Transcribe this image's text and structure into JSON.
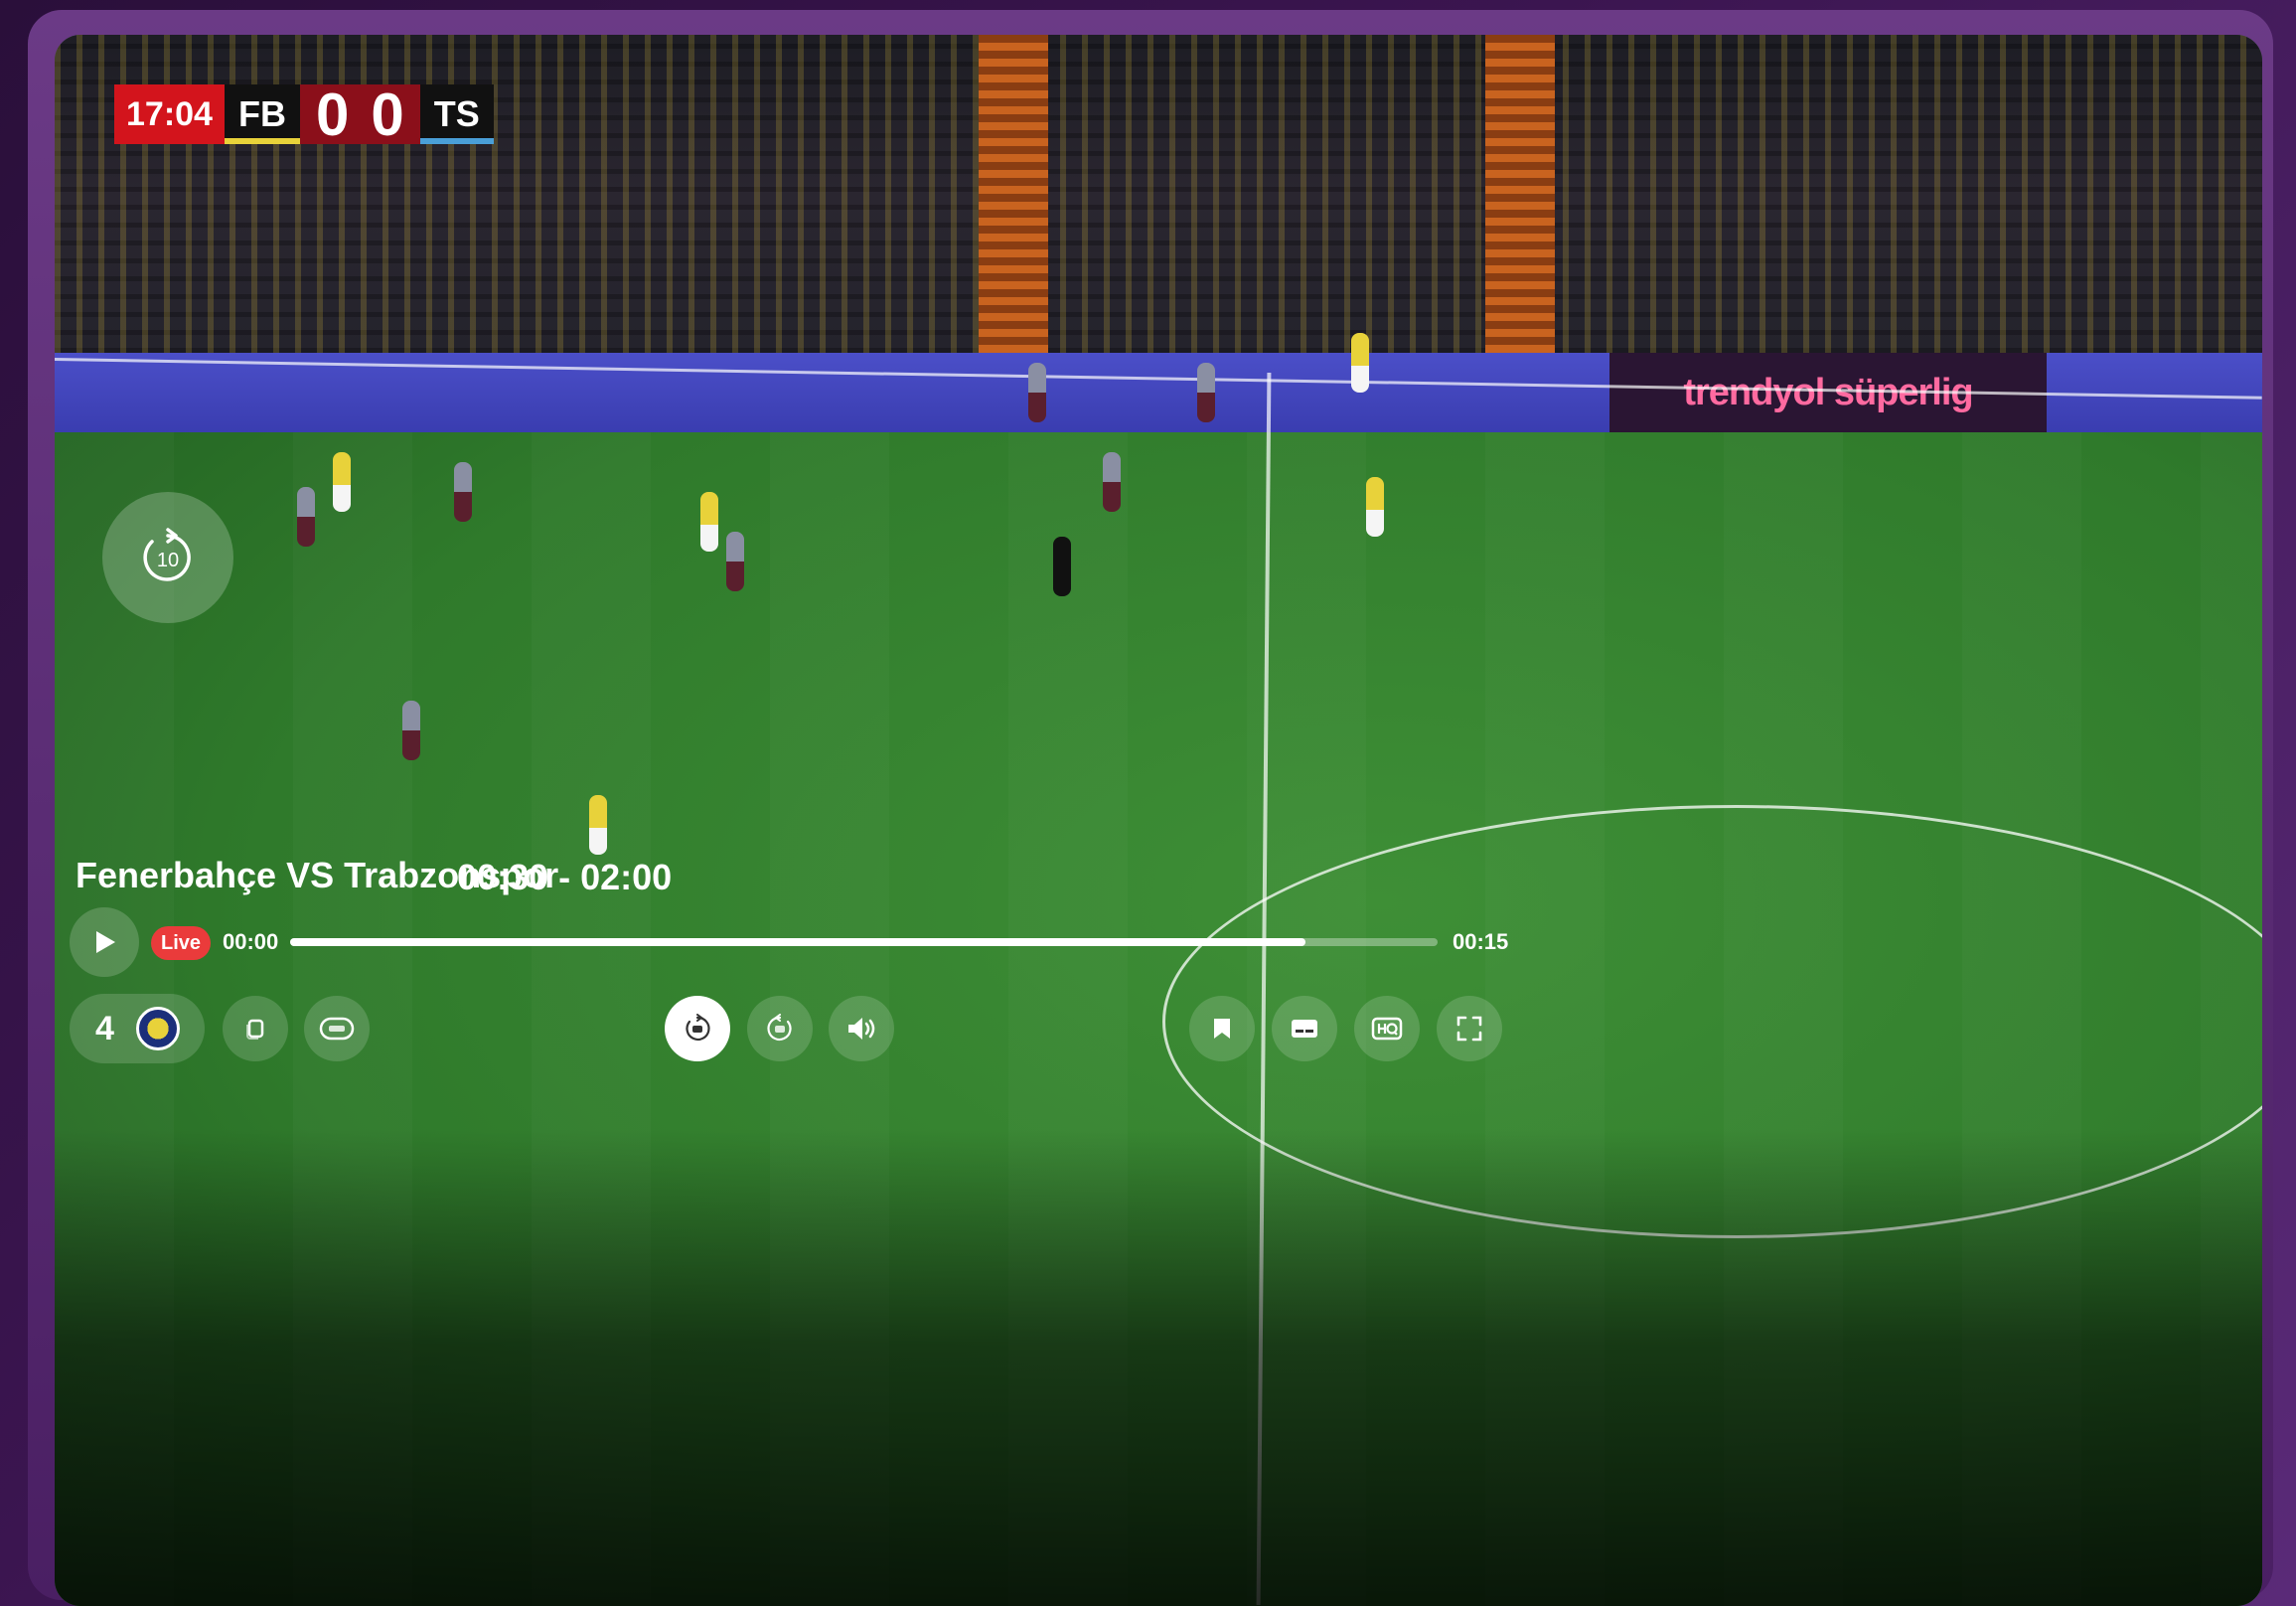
{
  "scoreboard": {
    "clock": "17:04",
    "home": "FB",
    "home_goals": "0",
    "away_goals": "0",
    "away": "TS"
  },
  "ad_board": {
    "brand": "trendyol süperlig"
  },
  "match": {
    "title": "Fenerbahçe VS Trabzonspor",
    "time_range": "00:30 - 02:00"
  },
  "playback": {
    "live_label": "Live",
    "current_time": "00:00",
    "end_time": "00:15",
    "progress": 0.885
  },
  "channel": {
    "number": "4"
  },
  "icons": {
    "replay_big": "replay-10-icon",
    "play": "play-icon",
    "copy": "copy-icon",
    "epg": "epg-icon",
    "rewind": "rewind-10-icon",
    "forward": "forward-10-icon",
    "volume": "volume-icon",
    "bookmark": "bookmark-icon",
    "subtitles": "subtitles-icon",
    "hq": "hq-icon",
    "fullscreen": "fullscreen-icon"
  },
  "colors": {
    "accent": "#ea3b3b",
    "clock_bg": "#d3141c",
    "frame": "#4a1f63"
  }
}
